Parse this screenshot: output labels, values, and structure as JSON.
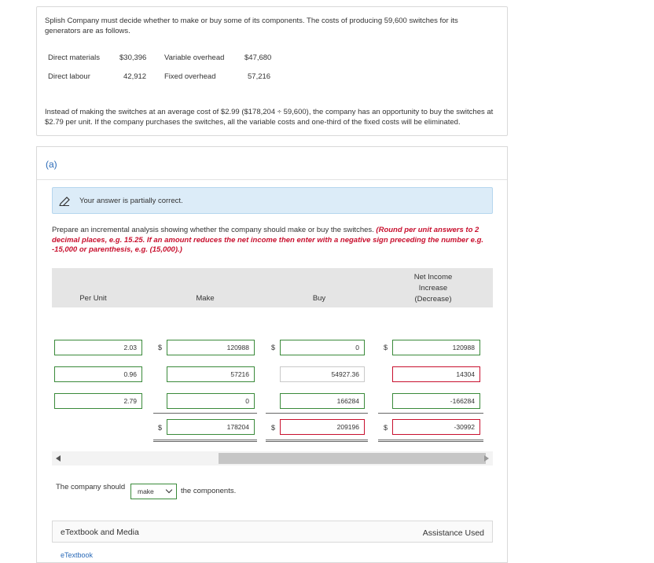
{
  "problem": {
    "intro": "Splish Company must decide whether to make or buy some of its components. The costs of producing 59,600 switches for its generators are as follows.",
    "costs": [
      {
        "label1": "Direct materials",
        "value1": "$30,396",
        "label2": "Variable overhead",
        "value2": "$47,680"
      },
      {
        "label1": "Direct labour",
        "value1": "42,912",
        "label2": "Fixed overhead",
        "value2": "57,216"
      }
    ],
    "text2": "Instead of making the switches at an average cost of $2.99 ($178,204 ÷ 59,600), the company has an opportunity to buy the switches at $2.79 per unit. If the company purchases the switches, all the variable costs and one-third of the fixed costs will be eliminated."
  },
  "part": {
    "label": "(a)",
    "feedback": "Your answer is partially correct.",
    "instruction_plain": "Prepare an incremental analysis showing whether the company should make or buy the switches.",
    "instruction_red": "(Round per unit answers to 2 decimal places, e.g. 15.25. If an amount reduces the net income then enter with a negative sign preceding the number e.g. -15,000 or parenthesis, e.g. (15,000).)"
  },
  "table": {
    "headers": {
      "per_unit": "Per Unit",
      "make": "Make",
      "buy": "Buy",
      "net_line1": "Net Income",
      "net_line2": "Increase",
      "net_line3": "(Decrease)"
    },
    "currency": "$",
    "rows": [
      {
        "per_unit": "2.03",
        "make": "120988",
        "buy": "0",
        "net": "120988"
      },
      {
        "per_unit": "0.96",
        "make": "57216",
        "buy": "54927.36",
        "net": "14304"
      },
      {
        "per_unit": "2.79",
        "make": "0",
        "buy": "166284",
        "net": "-166284"
      }
    ],
    "totals": {
      "make": "178204",
      "buy": "209196",
      "net": "-30992"
    }
  },
  "conclusion": {
    "prefix": "The company should",
    "selected": "make",
    "suffix": "the components."
  },
  "footer": {
    "etextbook_media": "eTextbook and Media",
    "assistance": "Assistance Used",
    "etextbook_link": "eTextbook"
  }
}
